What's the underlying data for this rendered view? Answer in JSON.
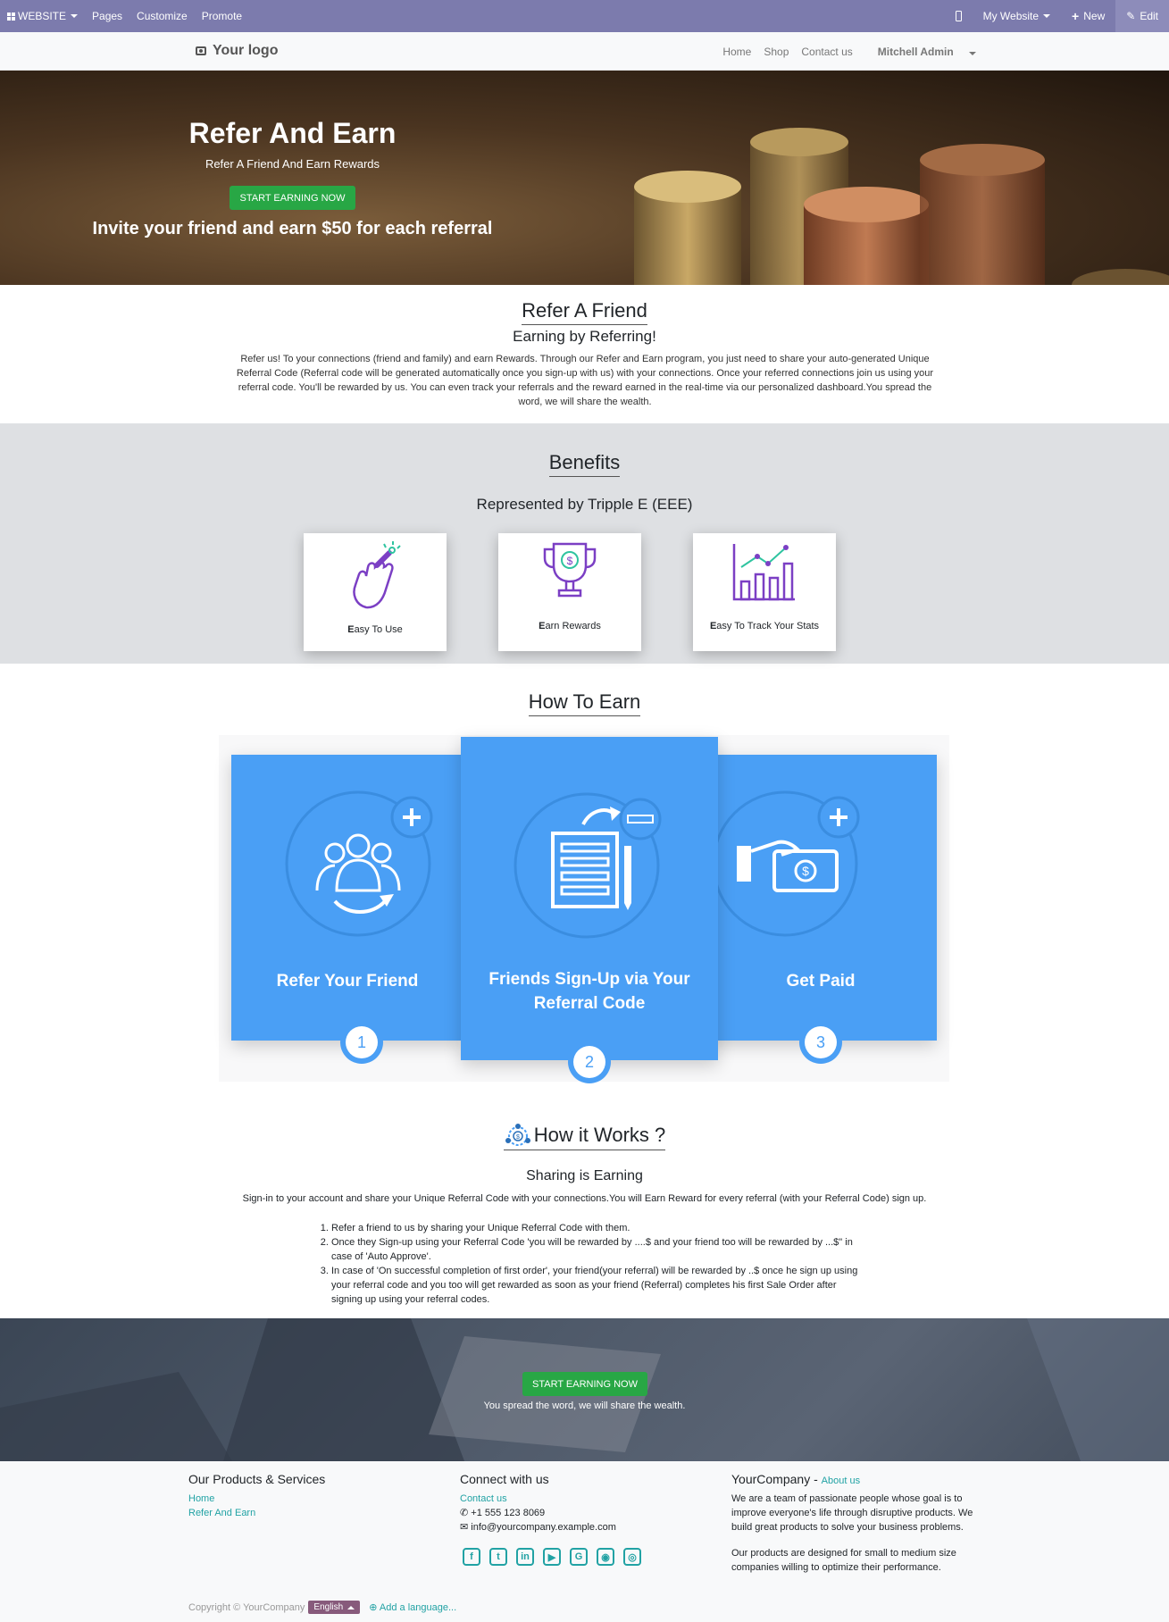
{
  "admin_bar": {
    "apps_label": "WEBSITE",
    "menu": [
      "Pages",
      "Customize",
      "Promote"
    ],
    "website_selector": "My Website",
    "new_label": "New",
    "edit_label": "Edit"
  },
  "header": {
    "logo_text": "Your logo",
    "nav": [
      "Home",
      "Shop",
      "Contact us"
    ],
    "user": "Mitchell Admin"
  },
  "hero": {
    "title": "Refer And Earn",
    "subtitle": "Refer A Friend And Earn Rewards",
    "button": "START EARNING NOW",
    "tagline": "Invite your friend and earn $50 for each referral"
  },
  "refer": {
    "title": "Refer A Friend",
    "subtitle": "Earning by Referring!",
    "text": "Refer us! To your connections (friend and family) and earn Rewards. Through our Refer and Earn program, you just need to share your auto-generated Unique Referral Code (Referral code will be generated automatically once you sign-up with us) with your connections. Once your referred connections join us using your referral code. You'll be rewarded by us. You can even track your referrals and the reward earned in the real-time via our personalized dashboard.You spread the word, we will share the wealth."
  },
  "benefits": {
    "title": "Benefits",
    "subtitle": "Represented by Tripple E (EEE)",
    "cards": [
      {
        "first": "E",
        "rest": "asy To Use"
      },
      {
        "first": "E",
        "rest": "arn Rewards"
      },
      {
        "first": "E",
        "rest": "asy To Track Your Stats"
      }
    ]
  },
  "how_to_earn": {
    "title": "How To Earn",
    "steps": [
      {
        "label": "Refer Your Friend",
        "number": "1"
      },
      {
        "label": "Friends Sign-Up via Your Referral Code",
        "number": "2"
      },
      {
        "label": "Get Paid",
        "number": "3"
      }
    ]
  },
  "how_it_works": {
    "title": "How it Works ?",
    "subtitle": "Sharing is Earning",
    "intro": "Sign-in to your account and share your Unique Referral Code with your connections.You will Earn Reward for every referral (with your Referral Code) sign up.",
    "items": [
      "Refer a friend to us by sharing your Unique Referral Code with them.",
      "Once they Sign-up using your Referral Code 'you will be rewarded by ....$ and your friend too will be rewarded by ...$\" in case of 'Auto Approve'.",
      "In case of 'On successful completion of first order', your friend(your referral) will be rewarded by ..$ once he sign up using your referral code and you too will get rewarded as soon as your friend (Referral) completes his first Sale Order after signing up using your referral codes."
    ]
  },
  "cta": {
    "button": "START EARNING NOW",
    "text": "You spread the word, we will share the wealth."
  },
  "footer": {
    "col1_title": "Our Products & Services",
    "col1_links": [
      "Home",
      "Refer And Earn"
    ],
    "col2_title": "Connect with us",
    "contact_link": "Contact us",
    "phone": "+1 555 123 8069",
    "email": "info@yourcompany.example.com",
    "social": [
      "facebook-icon",
      "twitter-icon",
      "linkedin-icon",
      "youtube-icon",
      "google-plus-icon",
      "github-icon",
      "instagram-icon"
    ],
    "col3_title": "YourCompany",
    "col3_sep": " - ",
    "about_link": "About us",
    "about_p1": "We are a team of passionate people whose goal is to improve everyone's life through disruptive products. We build great products to solve your business problems.",
    "about_p2": "Our products are designed for small to medium size companies willing to optimize their performance.",
    "copyright": "Copyright © YourCompany",
    "language": "English",
    "add_language": "Add a language..."
  },
  "colors": {
    "admin_bar": "#7c7bad",
    "green_button": "#28a745",
    "earn_blue": "#4a9ff5",
    "link_teal": "#21a2a4",
    "benefit_purple": "#7b3fc4"
  }
}
